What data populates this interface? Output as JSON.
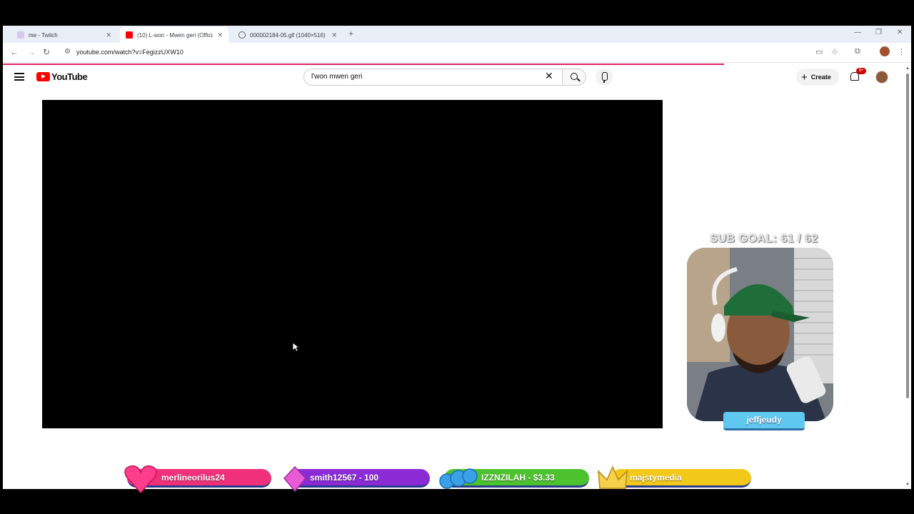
{
  "browser": {
    "tabs": [
      {
        "title": "me - Twitch",
        "active": false
      },
      {
        "title": "(10) L-won - Mwen geri (Officia",
        "active": true
      },
      {
        "title": "000002184-05.gif (1040×516)",
        "active": false
      }
    ],
    "new_tab": "+",
    "url": "youtube.com/watch?v=FegizzUXW10"
  },
  "youtube": {
    "logo_text": "YouTube",
    "search_value": "l'won mwen geri",
    "create_label": "Create",
    "notification_count": "9+"
  },
  "overlay": {
    "sub_goal": "SUB GOAL: 61 / 62",
    "streamer": "jeffjeudy",
    "alerts": [
      {
        "label": "merlineorilus24",
        "color": "#f0307a",
        "icon": "heart-icon"
      },
      {
        "label": "smith12567 - 100",
        "color": "#8a2bd6",
        "icon": "diamond-icon"
      },
      {
        "label": "IZZNZILAH - $3.33",
        "color": "#4cc22e",
        "icon": "coins-icon"
      },
      {
        "label": "majstymedia",
        "color": "#f2c81a",
        "icon": "crown-icon"
      }
    ]
  },
  "colors": {
    "youtube_red": "#ff0000",
    "progress": "#e0245e",
    "name_tag": "#5fc8f0"
  }
}
